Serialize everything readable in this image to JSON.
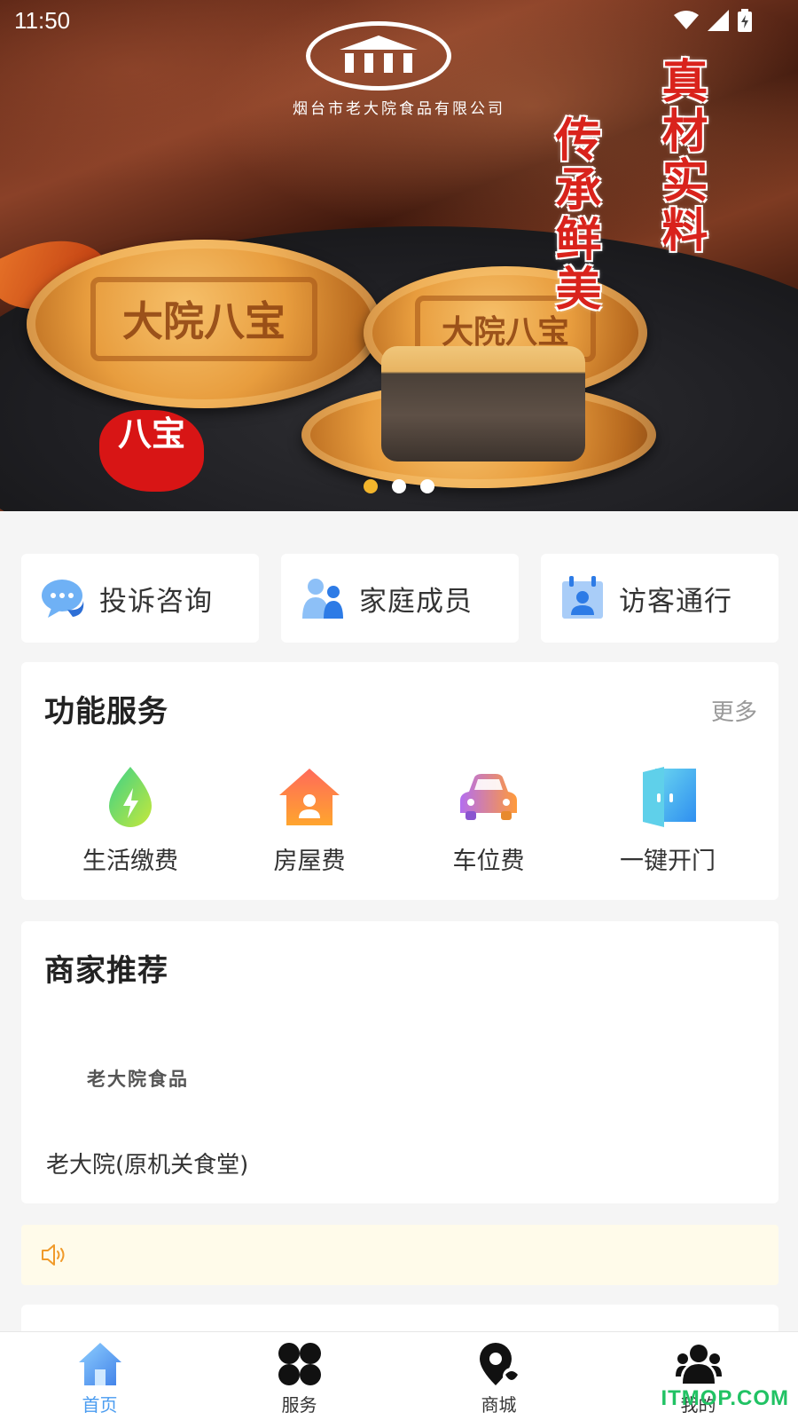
{
  "status_bar": {
    "time": "11:50"
  },
  "banner": {
    "company_name": "烟台市老大院食品有限公司",
    "slogan_right": "真材实料",
    "slogan_left": "传承鲜美",
    "cake_stamp_1": "大院八宝",
    "cake_stamp_2": "大院八宝",
    "red_seal": "八宝",
    "carousel": {
      "total": 3,
      "active_index": 0
    }
  },
  "quick_actions": [
    {
      "label": "投诉咨询",
      "icon": "chat-bubble-icon"
    },
    {
      "label": "家庭成员",
      "icon": "family-members-icon"
    },
    {
      "label": "访客通行",
      "icon": "visitor-pass-icon"
    }
  ],
  "services": {
    "title": "功能服务",
    "more": "更多",
    "items": [
      {
        "label": "生活缴费",
        "icon": "utility-bolt-drop-icon"
      },
      {
        "label": "房屋费",
        "icon": "house-fee-icon"
      },
      {
        "label": "车位费",
        "icon": "car-icon"
      },
      {
        "label": "一键开门",
        "icon": "door-open-icon"
      }
    ]
  },
  "merchants": {
    "title": "商家推荐",
    "logo_text": "老大院食品",
    "name": "老大院(原机关食堂)"
  },
  "notice": {
    "icon": "speaker-icon"
  },
  "tabbar": {
    "tabs": [
      {
        "label": "首页",
        "icon": "home-icon",
        "active": true
      },
      {
        "label": "服务",
        "icon": "grid-clover-icon",
        "active": false
      },
      {
        "label": "商城",
        "icon": "location-pin-icon",
        "active": false
      },
      {
        "label": "我的",
        "icon": "user-group-icon",
        "active": false
      }
    ]
  },
  "watermark": "ITMOP.COM",
  "colors": {
    "accent": "#4a9cf0",
    "indicator_active": "#f3b52c",
    "notice_bg": "#fffbea",
    "watermark": "#21c264"
  }
}
